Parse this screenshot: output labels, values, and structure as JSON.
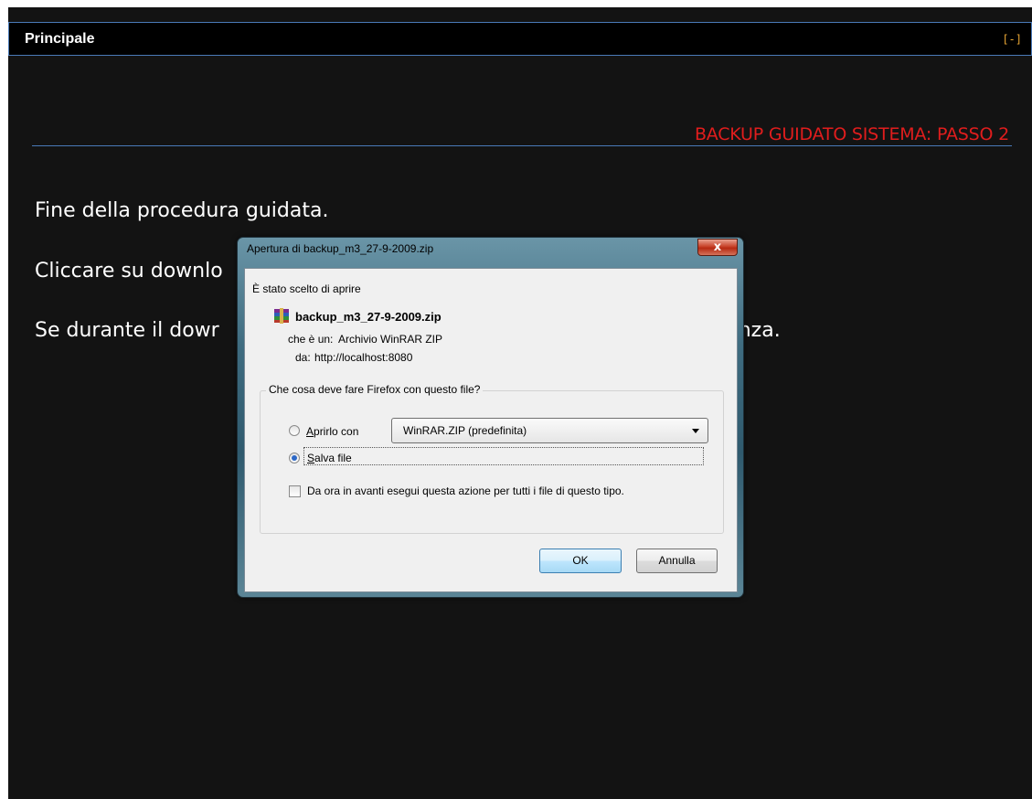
{
  "panel": {
    "title": "Principale",
    "collapse_label": "[-]"
  },
  "wizard": {
    "title": "BACKUP GUIDATO SISTEMA: PASSO 2",
    "title_color": "#e01d1d",
    "lines": [
      "Fine della procedura guidata.",
      "Cliccare su downlo",
      "Se durante il dowr",
      "nza."
    ]
  },
  "dialog": {
    "title": "Apertura di backup_m3_27-9-2009.zip",
    "close_label": "x",
    "intro": "È stato scelto di aprire",
    "file_icon": "winrar-archive-icon",
    "filename": "backup_m3_27-9-2009.zip",
    "type_label": "che è un:",
    "type_value": "Archivio WinRAR ZIP",
    "from_label": "da:",
    "from_value": "http://localhost:8080",
    "group_label": "Che cosa deve fare Firefox con questo file?",
    "open_with_label": "Aprirlo con",
    "open_with_selected": "WinRAR.ZIP (predefinita)",
    "save_label": "Salva file",
    "remember_label": "Da ora in avanti esegui questa azione per tutti i file di questo tipo.",
    "selected_option": "save",
    "remember_checked": false,
    "ok_label": "OK",
    "cancel_label": "Annulla"
  }
}
